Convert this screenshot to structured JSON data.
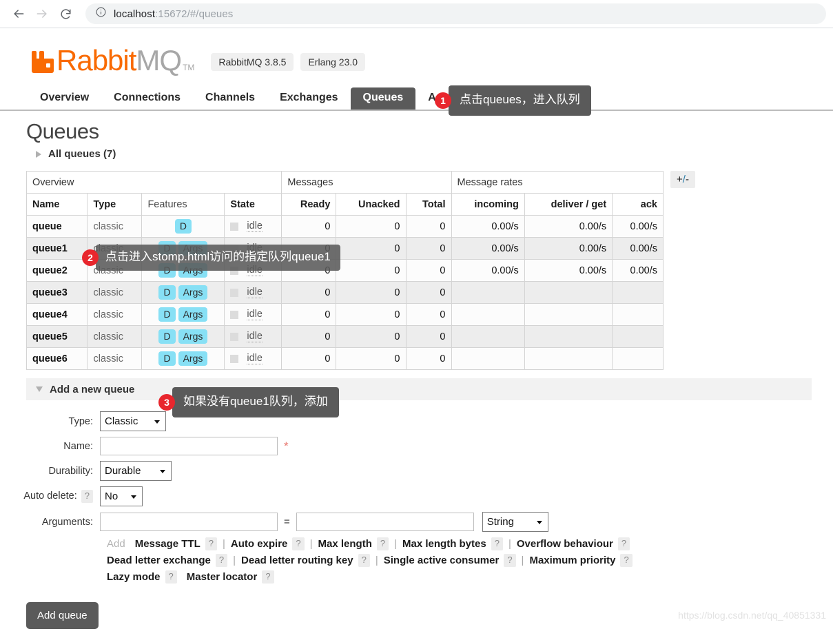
{
  "browser": {
    "back_icon": "arrow-left-icon",
    "forward_icon": "arrow-right-icon",
    "reload_icon": "reload-icon",
    "info_icon": "info-circle-icon",
    "url_host": "localhost",
    "url_rest": ":15672/#/queues"
  },
  "brand": {
    "name_primary": "Rabbit",
    "name_secondary": "MQ",
    "tm": "TM",
    "badges": [
      "RabbitMQ 3.8.5",
      "Erlang 23.0"
    ],
    "accent_color": "#f96a02",
    "logo_icon": "rabbitmq-logo-icon"
  },
  "nav": {
    "tabs": [
      {
        "label": "Overview",
        "active": false
      },
      {
        "label": "Connections",
        "active": false
      },
      {
        "label": "Channels",
        "active": false
      },
      {
        "label": "Exchanges",
        "active": false
      },
      {
        "label": "Queues",
        "active": true
      },
      {
        "label": "Admin",
        "active": false
      }
    ],
    "active_bg": "#5a5a5a"
  },
  "page": {
    "title": "Queues",
    "all_queues_label": "All queues (7)"
  },
  "table": {
    "groups": [
      {
        "label": "Overview",
        "span": 4
      },
      {
        "label": "Messages",
        "span": 3
      },
      {
        "label": "Message rates",
        "span": 3
      }
    ],
    "columns": [
      "Name",
      "Type",
      "Features",
      "State",
      "Ready",
      "Unacked",
      "Total",
      "incoming",
      "deliver / get",
      "ack"
    ],
    "toggle_columns_label": "+/-",
    "state_text": "idle",
    "rows": [
      {
        "name": "queue",
        "type": "classic",
        "features": [
          "D"
        ],
        "state": "idle",
        "ready": "0",
        "unacked": "0",
        "total": "0",
        "incoming": "0.00/s",
        "deliver_get": "0.00/s",
        "ack": "0.00/s"
      },
      {
        "name": "queue1",
        "type": "classic",
        "features": [
          "D",
          "Args"
        ],
        "state": "idle",
        "ready": "0",
        "unacked": "0",
        "total": "0",
        "incoming": "0.00/s",
        "deliver_get": "0.00/s",
        "ack": "0.00/s"
      },
      {
        "name": "queue2",
        "type": "classic",
        "features": [
          "D",
          "Args"
        ],
        "state": "idle",
        "ready": "0",
        "unacked": "0",
        "total": "0",
        "incoming": "0.00/s",
        "deliver_get": "0.00/s",
        "ack": "0.00/s"
      },
      {
        "name": "queue3",
        "type": "classic",
        "features": [
          "D",
          "Args"
        ],
        "state": "idle",
        "ready": "0",
        "unacked": "0",
        "total": "0",
        "incoming": "",
        "deliver_get": "",
        "ack": ""
      },
      {
        "name": "queue4",
        "type": "classic",
        "features": [
          "D",
          "Args"
        ],
        "state": "idle",
        "ready": "0",
        "unacked": "0",
        "total": "0",
        "incoming": "",
        "deliver_get": "",
        "ack": ""
      },
      {
        "name": "queue5",
        "type": "classic",
        "features": [
          "D",
          "Args"
        ],
        "state": "idle",
        "ready": "0",
        "unacked": "0",
        "total": "0",
        "incoming": "",
        "deliver_get": "",
        "ack": ""
      },
      {
        "name": "queue6",
        "type": "classic",
        "features": [
          "D",
          "Args"
        ],
        "state": "idle",
        "ready": "0",
        "unacked": "0",
        "total": "0",
        "incoming": "",
        "deliver_get": "",
        "ack": ""
      }
    ]
  },
  "add_queue": {
    "section_label": "Add a new queue",
    "fields": {
      "type_label": "Type:",
      "type_value": "Classic",
      "name_label": "Name:",
      "name_value": "",
      "name_required_mark": "*",
      "durability_label": "Durability:",
      "durability_value": "Durable",
      "auto_delete_label": "Auto delete:",
      "auto_delete_value": "No",
      "arguments_label": "Arguments:",
      "argument_key": "",
      "argument_value": "",
      "argument_equals": "=",
      "argument_type_value": "String",
      "help_mark": "?"
    },
    "add_presets_label": "Add",
    "presets": [
      [
        "Message TTL",
        "Auto expire",
        "Max length",
        "Max length bytes",
        "Overflow behaviour"
      ],
      [
        "Dead letter exchange",
        "Dead letter routing key",
        "Single active consumer",
        "Maximum priority"
      ],
      [
        "Lazy mode",
        "Master locator"
      ]
    ],
    "submit_label": "Add queue"
  },
  "annotations": [
    {
      "number": "1",
      "text": "点击queues，进入队列"
    },
    {
      "number": "2",
      "text": "点击进入stomp.html访问的指定队列queue1"
    },
    {
      "number": "3",
      "text": "如果没有queue1队列，添加"
    }
  ],
  "watermark": "https://blog.csdn.net/qq_40851331"
}
